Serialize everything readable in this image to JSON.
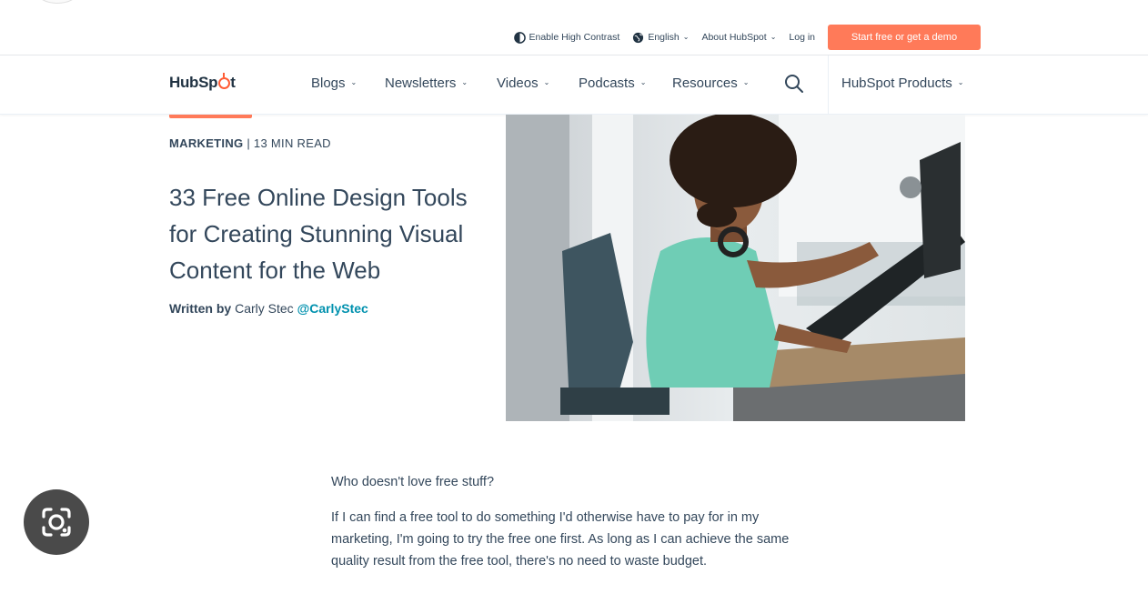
{
  "utility_nav": {
    "contrast_label": "Enable High Contrast",
    "language_label": "English",
    "about_label": "About HubSpot",
    "login_label": "Log in",
    "cta_label": "Start free or get a demo"
  },
  "main_nav": {
    "logo_text_a": "HubSp",
    "logo_text_b": "t",
    "items": [
      {
        "label": "Blogs"
      },
      {
        "label": "Newsletters"
      },
      {
        "label": "Videos"
      },
      {
        "label": "Podcasts"
      },
      {
        "label": "Resources"
      }
    ],
    "products_label": "HubSpot Products"
  },
  "article": {
    "topic": "MARKETING",
    "read_time": "| 13 MIN READ",
    "title": "33 Free Online Design Tools for Creating Stunning Visual Content for the Web",
    "written_by_label": "Written by",
    "author": "Carly Stec",
    "author_handle": "@CarlyStec",
    "paragraphs": [
      "Who doesn't love free stuff?",
      "If I can find a free tool to do something I'd otherwise have to pay for in my marketing, I'm going to try the free one first. As long as I can achieve the same quality result from the free tool, there's no need to waste budget."
    ]
  },
  "colors": {
    "accent": "#ff7a59",
    "text": "#33475b",
    "link": "#0091ae"
  },
  "icons": {
    "contrast": "contrast-icon",
    "language": "globe-icon",
    "search": "search-icon",
    "lens": "google-lens-icon"
  }
}
